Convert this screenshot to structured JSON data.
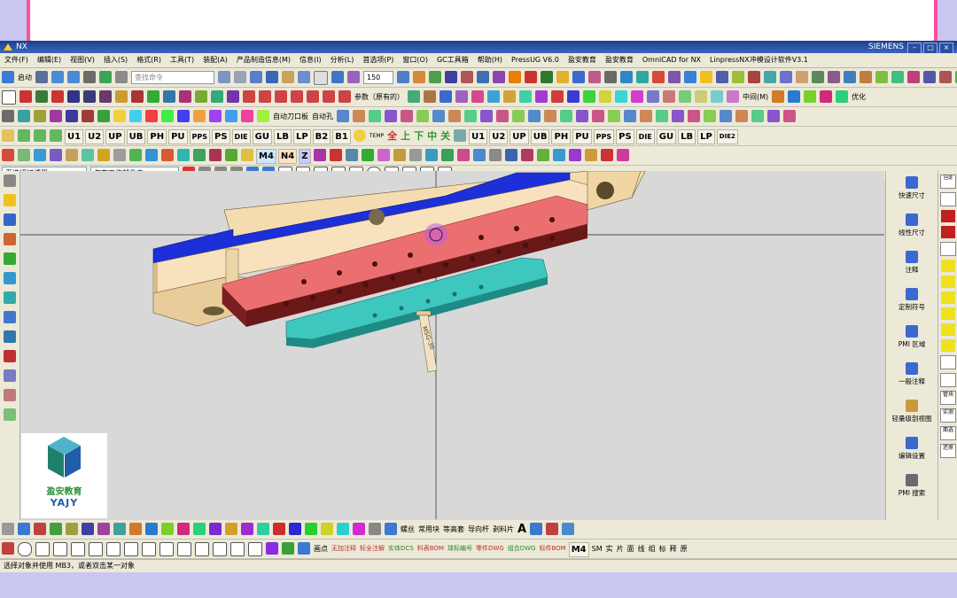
{
  "window": {
    "title": "NX",
    "title_right": "SIEMENS"
  },
  "menu": [
    "文件(F)",
    "编辑(E)",
    "视图(V)",
    "插入(S)",
    "格式(R)",
    "工具(T)",
    "装配(A)",
    "产品制造信息(M)",
    "信息(I)",
    "分析(L)",
    "首选项(P)",
    "窗口(O)",
    "GC工具箱",
    "帮助(H)",
    "PressUG V6.0",
    "盈安教育",
    "盈安教育",
    "OmniCAD for NX",
    "LinpressNX冲模设计软件V3.1"
  ],
  "toolbar": {
    "start_label": "启动",
    "search_placeholder": "查找命令",
    "zoom_value": "150",
    "parameter_label": "参数（原有的）",
    "auto_tool_label": "自动刀口板",
    "auto_hole_label": "自动孔",
    "middle_label": "中间(M)",
    "optimize_label": "优化",
    "die_buttons": [
      "U1",
      "U2",
      "UP",
      "UB",
      "PH",
      "PU",
      "PPS",
      "PS",
      "DIE",
      "GU",
      "LB",
      "LP",
      "B2",
      "B1"
    ],
    "die_buttons_right": [
      "U1",
      "U2",
      "UP",
      "UB",
      "PH",
      "PU",
      "PPS",
      "PS",
      "DIE",
      "GU",
      "LB",
      "LP"
    ],
    "die2": "DIE2",
    "temp_label": "TEMP",
    "colored_chars": [
      "全",
      "上",
      "下",
      "中",
      "关"
    ],
    "m4": "M4",
    "n4": "N4",
    "z": "Z"
  },
  "selection": {
    "filter_value": "无选择过滤器",
    "scope_value": "仅在工作部件内"
  },
  "right_panel": [
    {
      "label": "快速尺寸",
      "icon": "quick-dimension-icon"
    },
    {
      "label": "线性尺寸",
      "icon": "linear-dimension-icon"
    },
    {
      "label": "注释",
      "icon": "note-icon"
    },
    {
      "label": "定制符号",
      "icon": "custom-symbol-icon"
    },
    {
      "label": "PMI 区域",
      "icon": "pmi-region-icon"
    },
    {
      "label": "一般注释",
      "icon": "general-note-icon"
    },
    {
      "label": "轻量级剖视图",
      "icon": "lightweight-section-icon"
    },
    {
      "label": "编辑设置",
      "icon": "edit-settings-icon"
    },
    {
      "label": "PMI 搜索",
      "icon": "pmi-search-icon"
    }
  ],
  "far_right": [
    "回退",
    "",
    "",
    "",
    "",
    "",
    "",
    "",
    "",
    "",
    "",
    "",
    "",
    "管块",
    "实测",
    "面选",
    "还原"
  ],
  "bottom_toolbar": {
    "labels": [
      "螺丝",
      "常用块",
      "等高套",
      "导向杆",
      "剥料片"
    ],
    "font_a": "A",
    "mid_labels": [
      "无加注释",
      "标全注解",
      "实体DCS",
      "料表BOM",
      "球标编号",
      "零件DWG",
      "组合DWG",
      "标件BOM"
    ],
    "m4": "M4",
    "sm": "SM",
    "tail": [
      "实",
      "片",
      "面",
      "线",
      "组",
      "标",
      "释",
      "原"
    ],
    "draw_label": "画点"
  },
  "status": {
    "message": "选择对象并使用 MB3，或者双击某一对象"
  },
  "watermark": {
    "chinese": "盈安教育",
    "english": "YAJY"
  },
  "part_label": "MSG-30",
  "colors": {
    "overlay_bg": "#c9c6f2",
    "title_pink": "#e6338a",
    "beige_plate": "#f5dcb0",
    "blue_plate": "#1c2fd8",
    "red_plate": "#ec6f6f",
    "cyan_block": "#3ec7bf"
  }
}
